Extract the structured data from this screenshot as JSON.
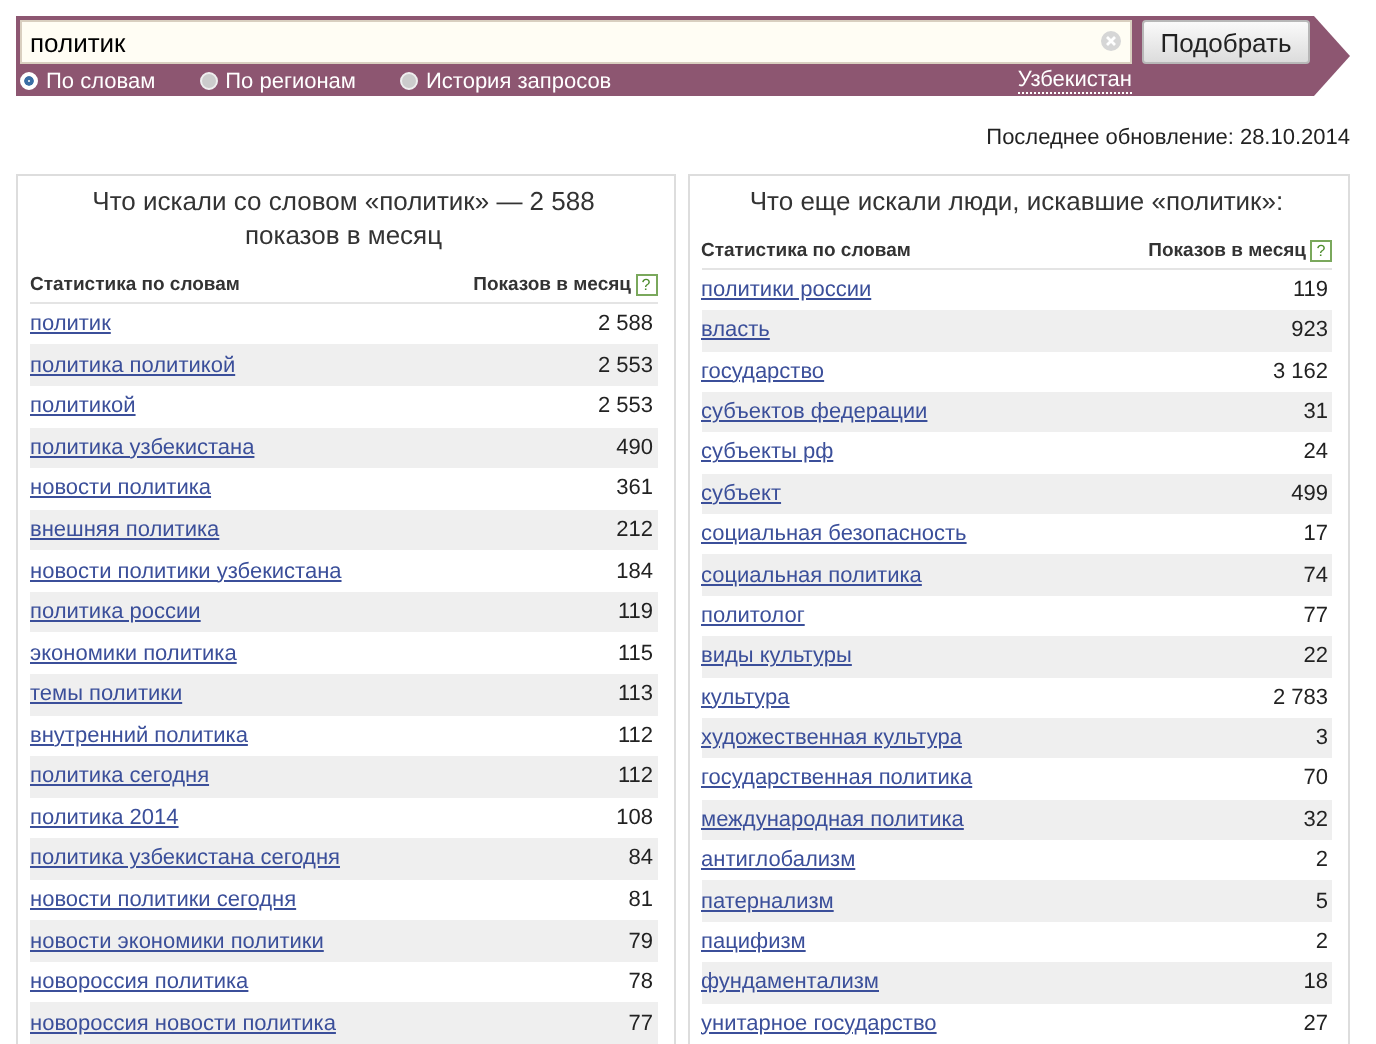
{
  "search": {
    "value": "политик",
    "button": "Подобрать",
    "modes": [
      {
        "label": "По словам",
        "selected": true
      },
      {
        "label": "По регионам",
        "selected": false
      },
      {
        "label": "История запросов",
        "selected": false
      }
    ],
    "region": "Узбекистан"
  },
  "last_update": "Последнее обновление: 28.10.2014",
  "panels": [
    {
      "title": "Что искали со словом «политик» — 2 588 показов в месяц",
      "columns": [
        "Статистика по словам",
        "Показов в месяц"
      ],
      "help": "?",
      "rows": [
        {
          "phrase": "политик",
          "count": "2 588"
        },
        {
          "phrase": "политика политикой",
          "count": "2 553"
        },
        {
          "phrase": "политикой",
          "count": "2 553"
        },
        {
          "phrase": "политика узбекистана",
          "count": "490"
        },
        {
          "phrase": "новости политика",
          "count": "361"
        },
        {
          "phrase": "внешняя политика",
          "count": "212"
        },
        {
          "phrase": "новости политики узбекистана",
          "count": "184"
        },
        {
          "phrase": "политика россии",
          "count": "119"
        },
        {
          "phrase": "экономики политика",
          "count": "115"
        },
        {
          "phrase": "темы политики",
          "count": "113"
        },
        {
          "phrase": "внутренний политика",
          "count": "112"
        },
        {
          "phrase": "политика сегодня",
          "count": "112"
        },
        {
          "phrase": "политика 2014",
          "count": "108"
        },
        {
          "phrase": "политика узбекистана сегодня",
          "count": "84"
        },
        {
          "phrase": "новости политики сегодня",
          "count": "81"
        },
        {
          "phrase": "новости экономики политики",
          "count": "79"
        },
        {
          "phrase": "новороссия политика",
          "count": "78"
        },
        {
          "phrase": "новороссия новости политика",
          "count": "77"
        }
      ]
    },
    {
      "title": "Что еще искали люди, искавшие «политик»:",
      "columns": [
        "Статистика по словам",
        "Показов в месяц"
      ],
      "help": "?",
      "rows": [
        {
          "phrase": "политики россии",
          "count": "119"
        },
        {
          "phrase": "власть",
          "count": "923"
        },
        {
          "phrase": "государство",
          "count": "3 162"
        },
        {
          "phrase": "субъектов федерации",
          "count": "31"
        },
        {
          "phrase": "субъекты рф",
          "count": "24"
        },
        {
          "phrase": "субъект",
          "count": "499"
        },
        {
          "phrase": "социальная безопасность",
          "count": "17"
        },
        {
          "phrase": "социальная политика",
          "count": "74"
        },
        {
          "phrase": "политолог",
          "count": "77"
        },
        {
          "phrase": "виды культуры",
          "count": "22"
        },
        {
          "phrase": "культура",
          "count": "2 783"
        },
        {
          "phrase": "художественная культура",
          "count": "3"
        },
        {
          "phrase": "государственная политика",
          "count": "70"
        },
        {
          "phrase": "международная политика",
          "count": "32"
        },
        {
          "phrase": "антиглобализм",
          "count": "2"
        },
        {
          "phrase": "патернализм",
          "count": "5"
        },
        {
          "phrase": "пацифизм",
          "count": "2"
        },
        {
          "phrase": "фундаментализм",
          "count": "18"
        },
        {
          "phrase": "унитарное государство",
          "count": "27"
        }
      ]
    }
  ]
}
